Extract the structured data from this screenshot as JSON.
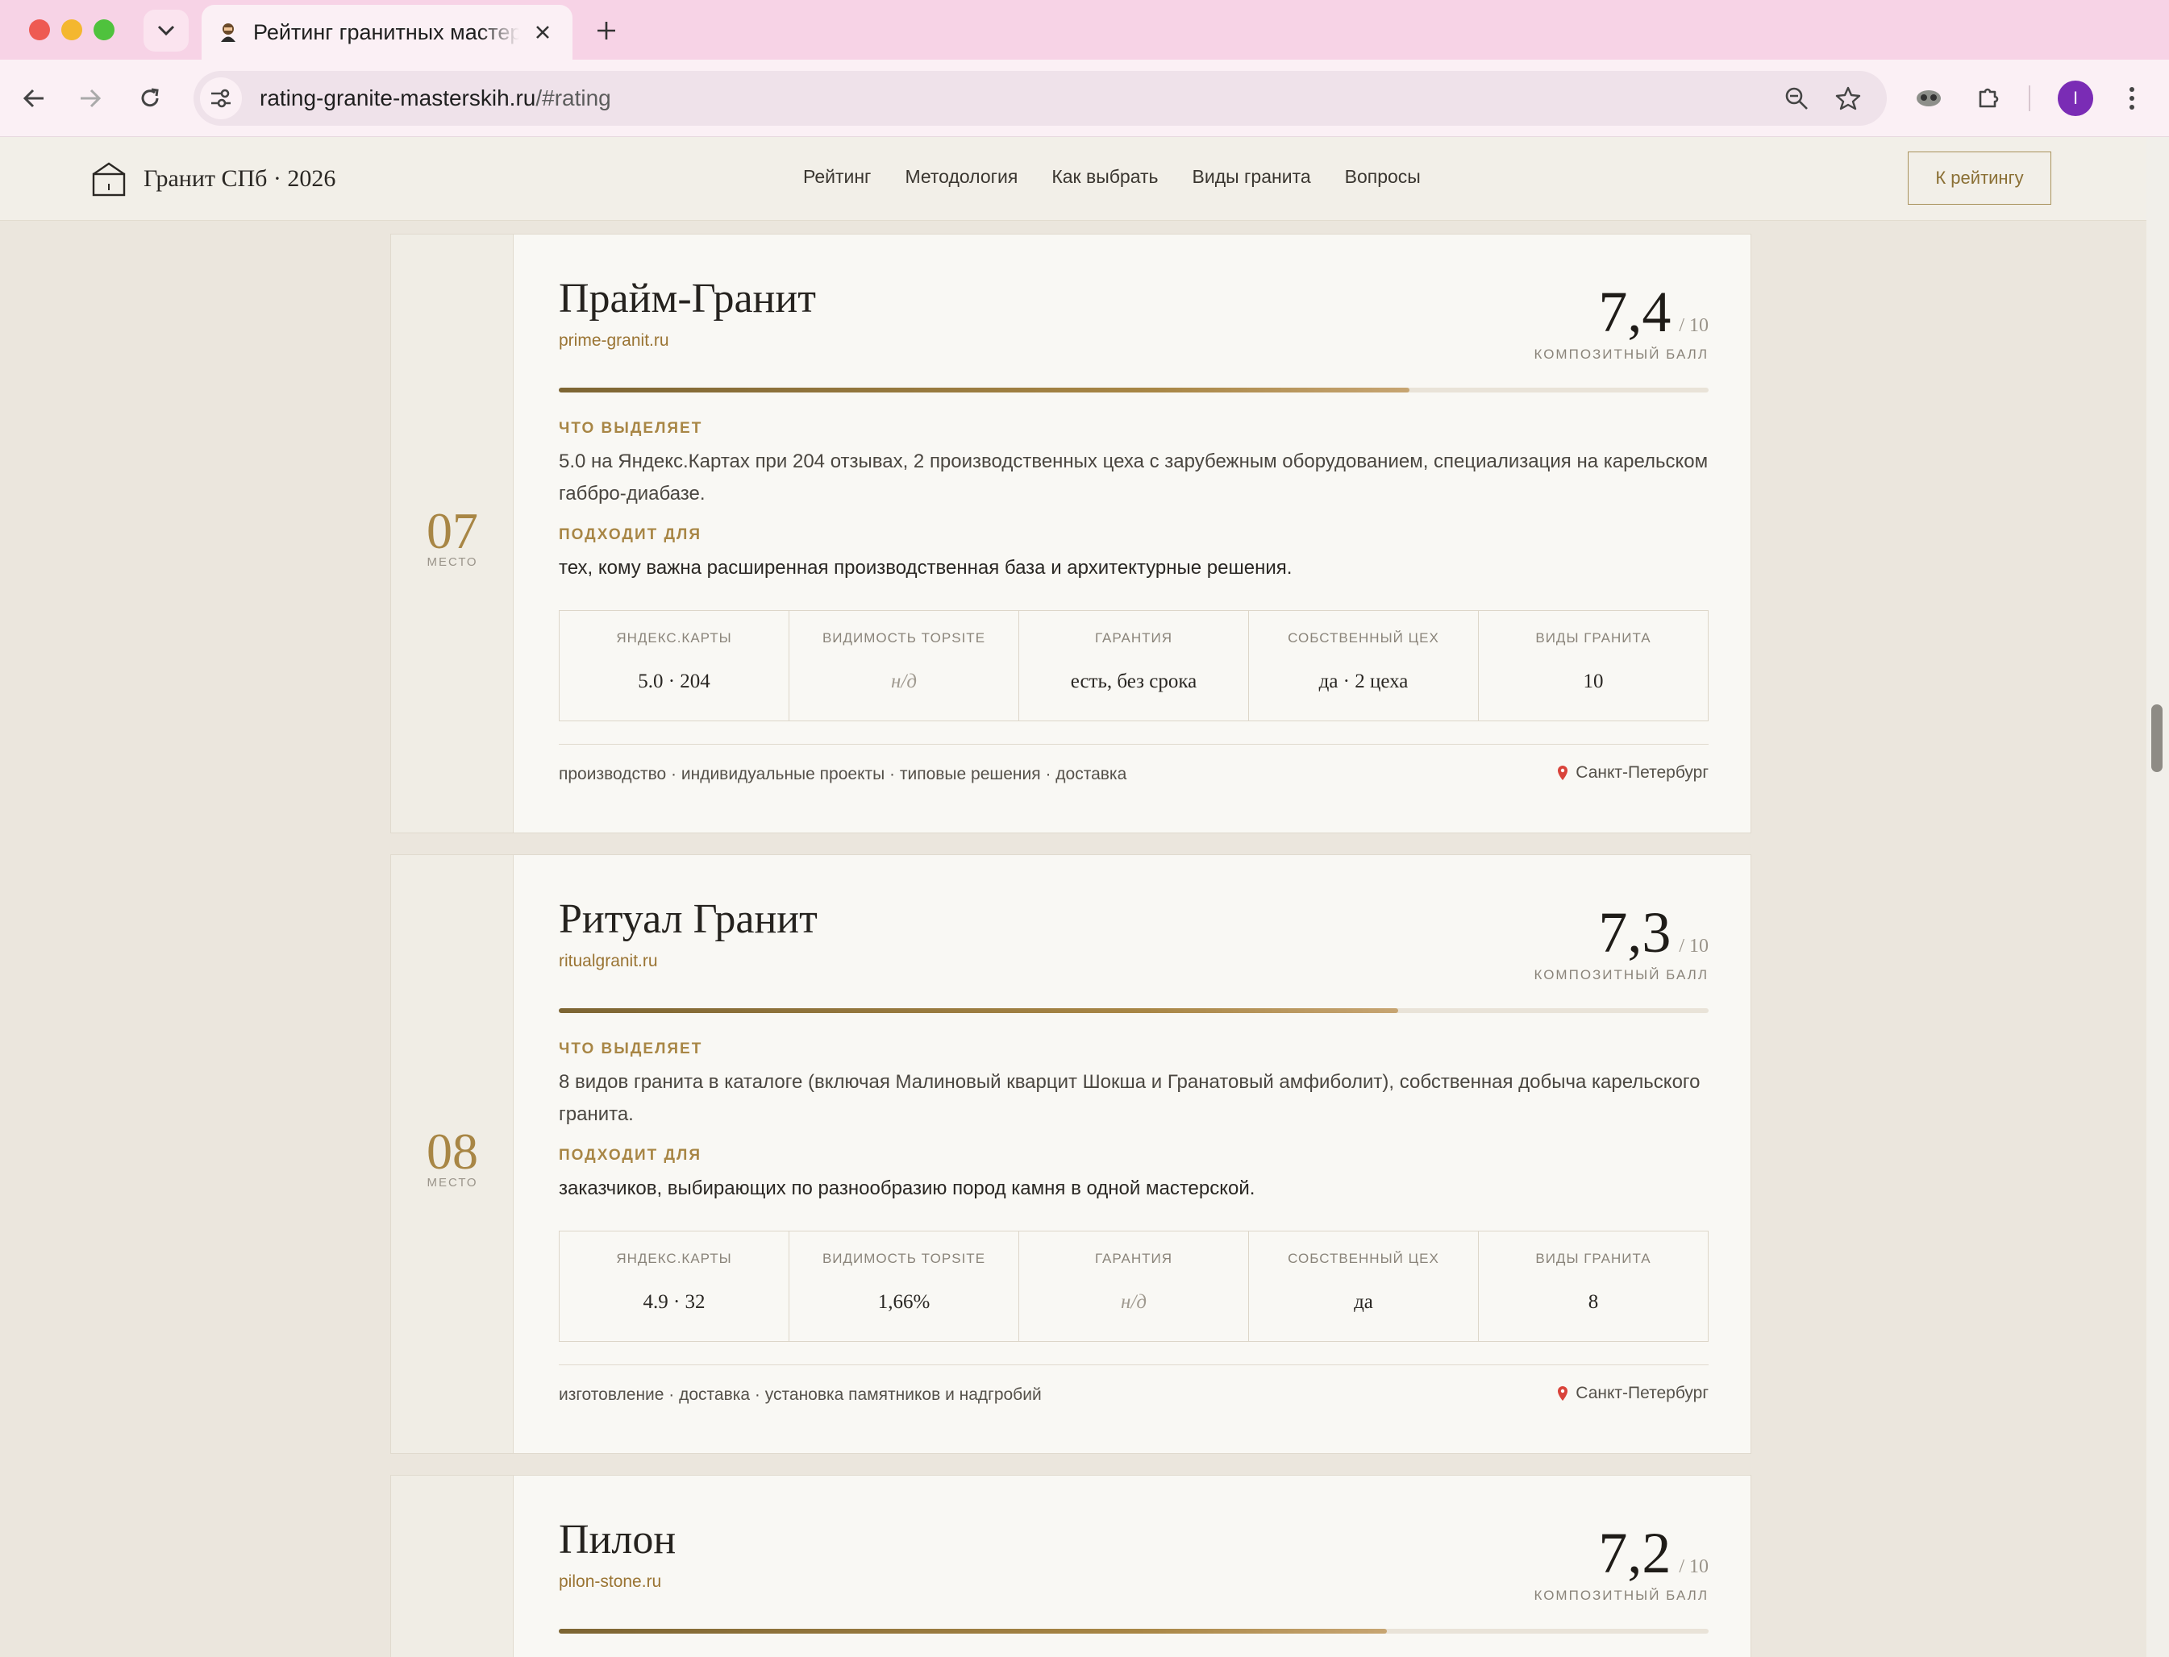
{
  "browser": {
    "tab_title": "Рейтинг гранитных мастерских",
    "url_host": "rating-granite-masterskih.ru",
    "url_path": "/#rating",
    "avatar_letter": "I",
    "accent_color": "#f7d3e6"
  },
  "header": {
    "logo_text": "Гранит СПб · 2026",
    "nav": [
      "Рейтинг",
      "Методология",
      "Как выбрать",
      "Виды гранита",
      "Вопросы"
    ],
    "cta_label": "К рейтингу"
  },
  "labels": {
    "rank": "МЕСТО",
    "score_max": "/ 10",
    "score_caption": "КОМПОЗИТНЫЙ БАЛЛ",
    "highlight": "ЧТО ВЫДЕЛЯЕТ",
    "fits": "ПОДХОДИТ ДЛЯ",
    "metric_names": [
      "ЯНДЕКС.КАРТЫ",
      "ВИДИМОСТЬ TOPSITE",
      "ГАРАНТИЯ",
      "СОБСТВЕННЫЙ ЦЕХ",
      "ВИДЫ ГРАНИТА"
    ]
  },
  "cards": [
    {
      "rank": "07",
      "name": "Прайм-Гранит",
      "domain": "prime-granit.ru",
      "score": "7,4",
      "score_fraction": 0.74,
      "highlight": "5.0 на Яндекс.Картах при 204 отзывах, 2 производственных цеха с зарубежным оборудованием, специализация на карельском габбро-диабазе.",
      "fits": "тех, кому важна расширенная производственная база и архитектурные решения.",
      "metrics": [
        "5.0 · 204",
        "н/д",
        "есть, без срока",
        "да · 2 цеха",
        "10"
      ],
      "services": "производство · индивидуальные проекты · типовые решения · доставка",
      "city": "Санкт-Петербург"
    },
    {
      "rank": "08",
      "name": "Ритуал Гранит",
      "domain": "ritualgranit.ru",
      "score": "7,3",
      "score_fraction": 0.73,
      "highlight": "8 видов гранита в каталоге (включая Малиновый кварцит Шокша и Гранатовый амфиболит), собственная добыча карельского гранита.",
      "fits": "заказчиков, выбирающих по разнообразию пород камня в одной мастерской.",
      "metrics": [
        "4.9 · 32",
        "1,66%",
        "н/д",
        "да",
        "8"
      ],
      "services": "изготовление · доставка · установка памятников и надгробий",
      "city": "Санкт-Петербург"
    },
    {
      "name": "Пилон",
      "domain": "pilon-stone.ru",
      "score": "7,2",
      "score_fraction": 0.72
    }
  ]
}
